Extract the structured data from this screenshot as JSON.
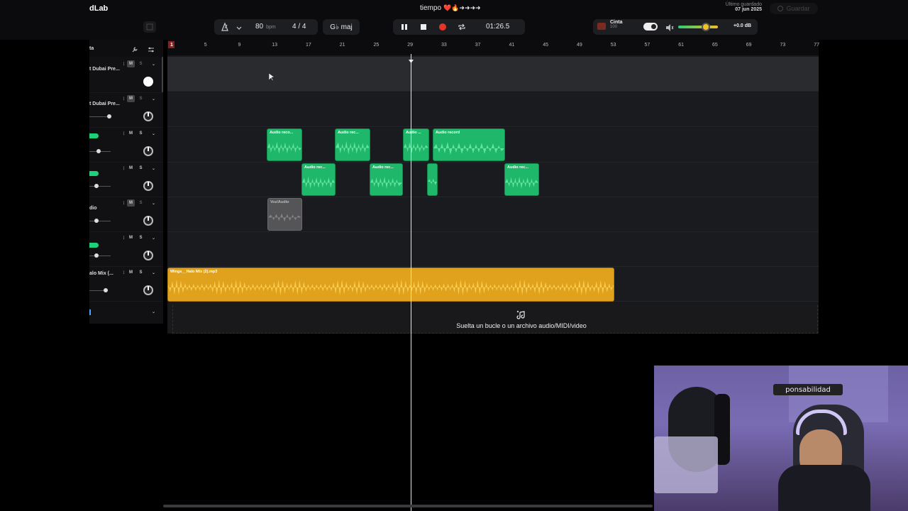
{
  "app": {
    "title_partial": "dLab"
  },
  "header": {
    "project_name": "tiempo",
    "project_suffix": "❤️🔥➜➜➜➜",
    "saved_label": "Último guardado",
    "saved_date": "07 jun 2025",
    "save_button": "Guardar"
  },
  "transport": {
    "bpm_value": "80",
    "bpm_unit": "bpm",
    "time_signature": "4 / 4",
    "key": "G♭ maj",
    "time_display": "01:26.5",
    "tape_label": "Cinta",
    "tape_value": "100",
    "volume_db": "+0.0 dB"
  },
  "track_panel": {
    "header_label": "ta",
    "mute_label": "M",
    "solo_label": "S",
    "tracks": [
      {
        "name": "t Dubai Pre..."
      },
      {
        "name": "t Dubai Pre..."
      },
      {
        "name": ""
      },
      {
        "name": ""
      },
      {
        "name": "dio"
      },
      {
        "name": ""
      },
      {
        "name": "alo Mix (..."
      }
    ],
    "green_tag": "dio"
  },
  "ruler": {
    "ticks": [
      "1",
      "5",
      "9",
      "13",
      "17",
      "21",
      "25",
      "29",
      "33",
      "37",
      "41",
      "45",
      "49",
      "53",
      "57",
      "61",
      "65",
      "69",
      "73",
      "77"
    ]
  },
  "clips": {
    "lane3": [
      "Audio reco...",
      "Audio rec...",
      "Audio ...",
      "Audio record"
    ],
    "lane4": [
      "Audio rec...",
      "Audio rec...",
      "",
      "Audio rec..."
    ],
    "lane5": [
      "Voz/Audio"
    ],
    "lane7": [
      "Wings__Halo Mix (2).mp3"
    ]
  },
  "dropzone": {
    "text": "Suelta un bucle o un archivo audio/MIDI/video"
  },
  "webcam": {
    "neon_sign": "ponsabilidad"
  },
  "colors": {
    "accent_green": "#1fb86a",
    "clip_yellow": "#e0a21c",
    "record_red": "#e5352b",
    "volume_knob": "#f2c029"
  }
}
